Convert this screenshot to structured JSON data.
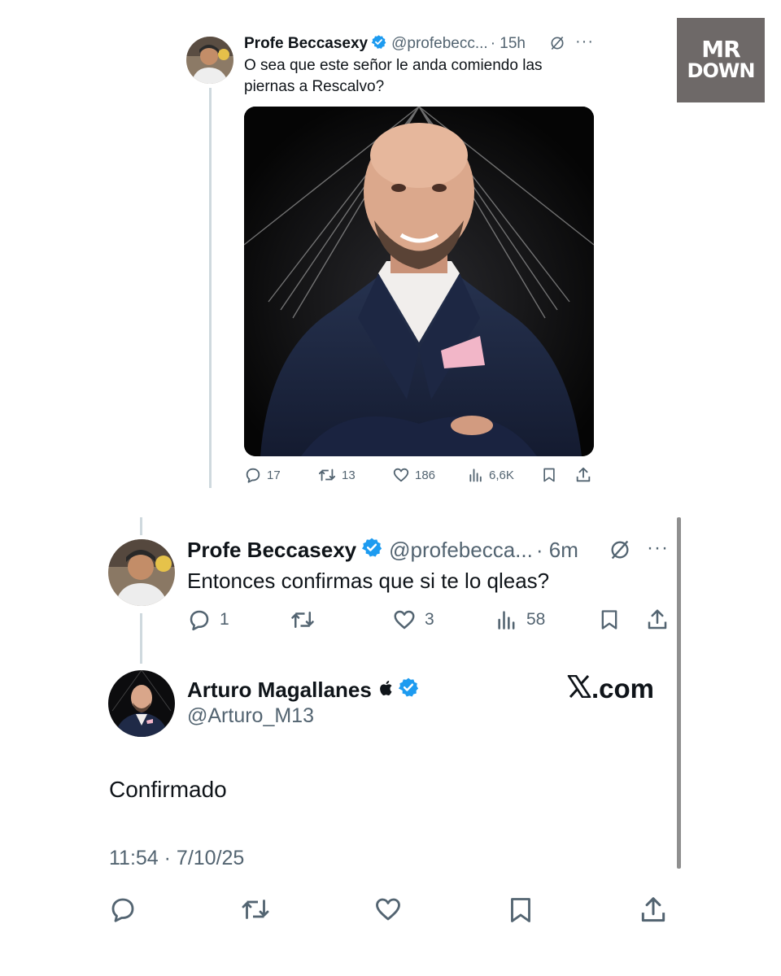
{
  "watermark": {
    "line1": "MR",
    "line2": "DOWN"
  },
  "tweets": [
    {
      "author": "Profe Beccasexy",
      "handle": "@profebecc...",
      "time": "· 15h",
      "text": "O sea que este señor le anda comiendo las piernas a Rescalvo?",
      "media": "photo",
      "stats": {
        "replies": "17",
        "reposts": "13",
        "likes": "186",
        "views": "6,6K"
      }
    },
    {
      "author": "Profe Beccasexy",
      "handle": "@profebecca...",
      "time": "· 6m",
      "text": "Entonces confirmas que si te lo qleas?",
      "stats": {
        "replies": "1",
        "reposts": "",
        "likes": "3",
        "views": "58"
      }
    },
    {
      "author": "Arturo Magallanes",
      "handle": "@Arturo_M13",
      "text": "Confirmado",
      "timestamp": "11:54 · 7/10/25"
    }
  ],
  "brand": {
    "logo": ".com"
  },
  "colors": {
    "verified": "#1d9bf0",
    "secondary_text": "#536471",
    "thread_line": "#cfd9de",
    "watermark_bg": "#6e6968"
  },
  "icons": [
    "reply-icon",
    "repost-icon",
    "like-icon",
    "views-icon",
    "bookmark-icon",
    "share-icon",
    "grok-icon",
    "more-icon",
    "verified-icon",
    "apple-icon",
    "x-logo-icon"
  ]
}
